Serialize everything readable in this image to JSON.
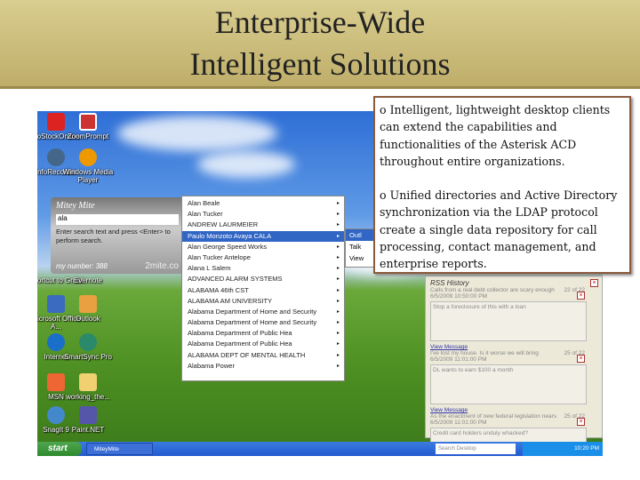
{
  "slide": {
    "title_line1": "Enterprise-Wide",
    "title_line2": "Intelligent Solutions"
  },
  "bullets": [
    "o  Intelligent, lightweight desktop clients can extend the capabilities and functionalities of the Asterisk ACD throughout entire organizations.",
    "o  Unified directories and Active Directory synchronization via the LDAP protocol create a single data repository for call processing, contact management, and enterprise reports."
  ],
  "desktop_icons": [
    "ZoStockOnline",
    "ZoomPrompt",
    "InfoRecorder",
    "Windows Media Player",
    "Shortcut to Gmail",
    "Evernote",
    "Microsoft Office A...",
    "Outlook",
    "Internet",
    "SmartSync Pro",
    "MSN",
    "working_the...",
    "SnagIt 9",
    "Paint.NET"
  ],
  "mitey": {
    "title": "Mitey Mite",
    "search_value": "ala",
    "hint": "Enter search text and press <Enter> to perform search.",
    "number_label": "my number: 388",
    "brand": "2mite.co"
  },
  "menu_items": [
    "Alan Beale",
    "Alan Tucker",
    "ANDREW LAURMEIER",
    "Paulo Monzoto Avaya CALA",
    "Alan George Speed Works",
    "Alan Tucker Antelope",
    "Alana L Salem",
    "ADVANCED ALARM SYSTEMS",
    "ALABAMA 46th CST",
    "ALABAMA AM UNIVERSITY",
    "Alabama Department of Home and Security",
    "Alabama Department of Home and Security",
    "Alabama Department of Public Hea",
    "Alabama Department of Public Hea",
    "ALABAMA DEPT OF MENTAL HEALTH",
    "Alabama Power"
  ],
  "submenu": [
    "Outl",
    "Talk",
    "View"
  ],
  "rss": {
    "title": "RSS History",
    "items": [
      {
        "headline": "Calls from a real debt collector are scary enough",
        "date": "6/5/2009 10:50:00 PM",
        "count": "22 of 22",
        "body": "Stop a foreclosure of this with a loan",
        "link": ""
      },
      {
        "headline": "I've lost my house. Is it worse we will bring",
        "date": "6/5/2009 11:01:00 PM",
        "count": "25 of 22",
        "body": "DL wants to earn $100 a month",
        "link": "View Message"
      },
      {
        "headline": "As the enactment of new federal legislation nears",
        "date": "6/5/2009 11:01:00 PM",
        "count": "25 of 22",
        "body": "Credit card holders unduly whacked?",
        "link": "View Message"
      }
    ]
  },
  "taskbar": {
    "start": "start",
    "task": "MiteyMite",
    "search_placeholder": "Search Desktop",
    "clock": "10:20 PM"
  }
}
